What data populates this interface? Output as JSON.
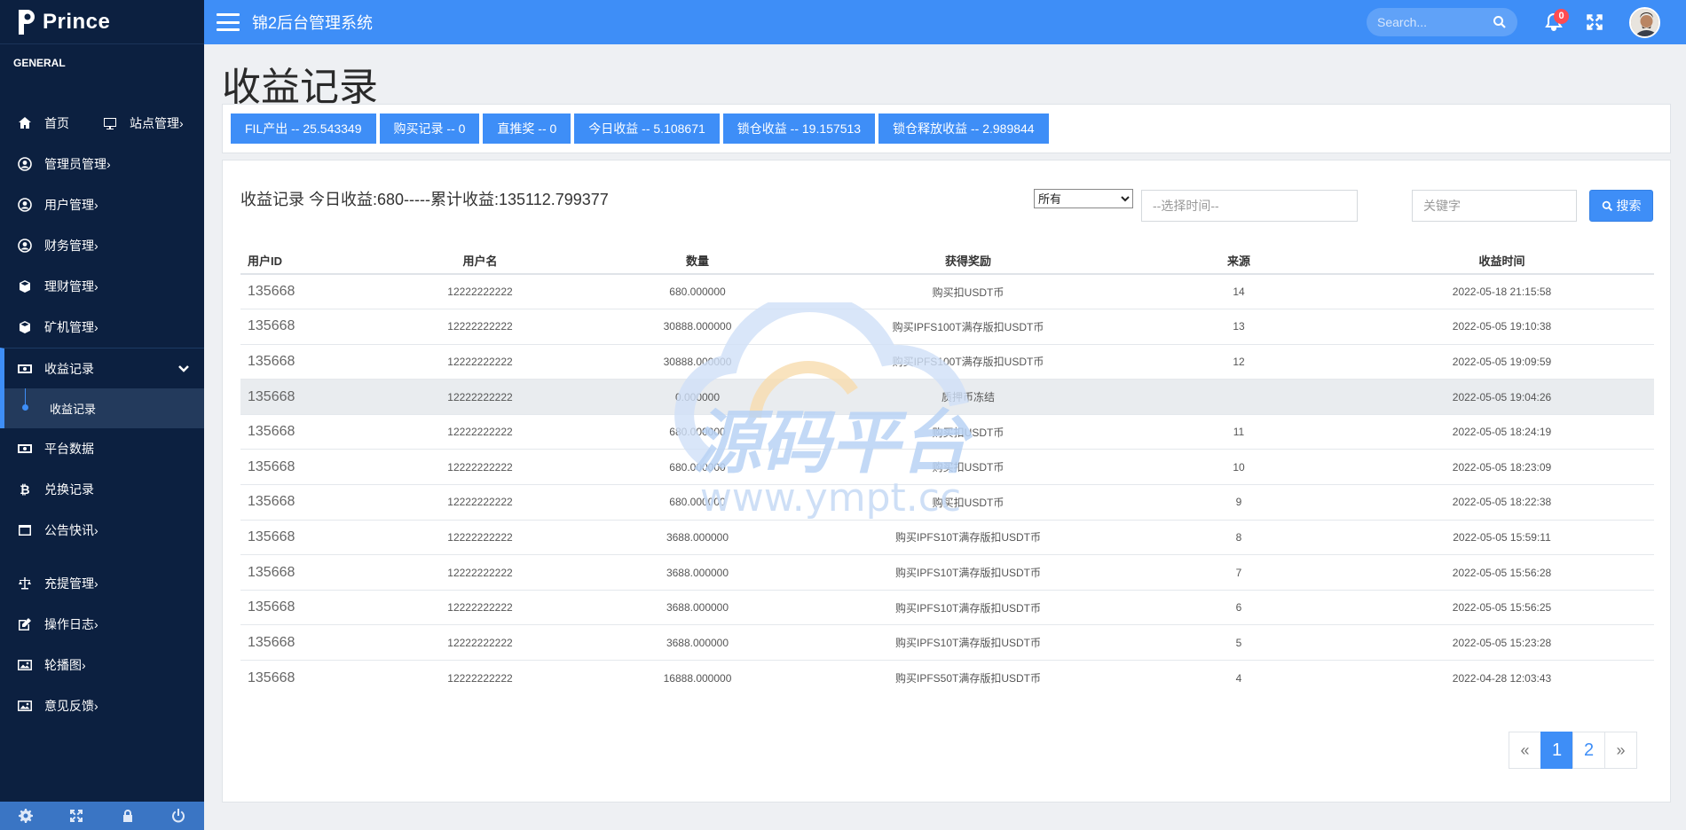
{
  "brand": {
    "name": "Prince"
  },
  "topbar": {
    "title": "锦2后台管理系统",
    "search_placeholder": "Search...",
    "notification_count": "0"
  },
  "sidebar": {
    "section_label": "GENERAL",
    "items": [
      {
        "label": "首页",
        "icon": "home-icon"
      },
      {
        "label": "站点管理",
        "icon": "monitor-icon"
      },
      {
        "label": "管理员管理",
        "icon": "user-circle-icon"
      },
      {
        "label": "用户管理",
        "icon": "user-circle-icon"
      },
      {
        "label": "财务管理",
        "icon": "user-circle-icon"
      },
      {
        "label": "理财管理",
        "icon": "cube-icon"
      },
      {
        "label": "矿机管理",
        "icon": "cube-icon"
      },
      {
        "label": "收益记录",
        "icon": "money-icon"
      },
      {
        "label": "收益记录",
        "icon": "dot-icon"
      },
      {
        "label": "平台数据",
        "icon": "money-icon"
      },
      {
        "label": "兑换记录",
        "icon": "bitcoin-icon"
      },
      {
        "label": "公告快讯",
        "icon": "window-icon"
      },
      {
        "label": "充提管理",
        "icon": "balance-scale-icon"
      },
      {
        "label": "操作日志",
        "icon": "edit-icon"
      },
      {
        "label": "轮播图",
        "icon": "image-icon"
      },
      {
        "label": "意见反馈",
        "icon": "image-icon"
      }
    ],
    "footer_icons": [
      "settings-icon",
      "fullscreen-icon",
      "lock-icon",
      "power-icon"
    ]
  },
  "page": {
    "title": "收益记录"
  },
  "stats": [
    "FIL产出 -- 25.543349",
    "购买记录 -- 0",
    "直推奖 -- 0",
    "今日收益 -- 5.108671",
    "锁仓收益 -- 19.157513",
    "锁仓释放收益 -- 2.989844"
  ],
  "panel": {
    "title": "收益记录 今日收益:680-----累计收益:135112.799377",
    "filter_selected": "所有",
    "time_placeholder": "--选择时间--",
    "keyword_placeholder": "关键字",
    "search_label": "搜索"
  },
  "table": {
    "columns": [
      "用户ID",
      "用户名",
      "数量",
      "获得奖励",
      "来源",
      "收益时间"
    ],
    "rows": [
      [
        "135668",
        "12222222222",
        "680.000000",
        "购买扣USDT币",
        "14",
        "2022-05-18 21:15:58"
      ],
      [
        "135668",
        "12222222222",
        "30888.000000",
        "购买IPFS100T满存版扣USDT币",
        "13",
        "2022-05-05 19:10:38"
      ],
      [
        "135668",
        "12222222222",
        "30888.000000",
        "购买IPFS100T满存版扣USDT币",
        "12",
        "2022-05-05 19:09:59"
      ],
      [
        "135668",
        "12222222222",
        "0.000000",
        "质押币冻结",
        "",
        "2022-05-05 19:04:26"
      ],
      [
        "135668",
        "12222222222",
        "680.000000",
        "购买扣USDT币",
        "11",
        "2022-05-05 18:24:19"
      ],
      [
        "135668",
        "12222222222",
        "680.000000",
        "购买扣USDT币",
        "10",
        "2022-05-05 18:23:09"
      ],
      [
        "135668",
        "12222222222",
        "680.000000",
        "购买扣USDT币",
        "9",
        "2022-05-05 18:22:38"
      ],
      [
        "135668",
        "12222222222",
        "3688.000000",
        "购买IPFS10T满存版扣USDT币",
        "8",
        "2022-05-05 15:59:11"
      ],
      [
        "135668",
        "12222222222",
        "3688.000000",
        "购买IPFS10T满存版扣USDT币",
        "7",
        "2022-05-05 15:56:28"
      ],
      [
        "135668",
        "12222222222",
        "3688.000000",
        "购买IPFS10T满存版扣USDT币",
        "6",
        "2022-05-05 15:56:25"
      ],
      [
        "135668",
        "12222222222",
        "3688.000000",
        "购买IPFS10T满存版扣USDT币",
        "5",
        "2022-05-05 15:23:28"
      ],
      [
        "135668",
        "12222222222",
        "16888.000000",
        "购买IPFS50T满存版扣USDT币",
        "4",
        "2022-04-28 12:03:43"
      ]
    ]
  },
  "pagination": {
    "prev": "«",
    "pages": [
      "1",
      "2"
    ],
    "current": "1",
    "next": "»"
  },
  "watermark": {
    "text_cn": "源码平台",
    "text_url": "www.ympt.cc"
  },
  "colors": {
    "primary": "#3e8ef7",
    "sidebar_bg": "#0c2040",
    "badge": "#ff4c52"
  }
}
